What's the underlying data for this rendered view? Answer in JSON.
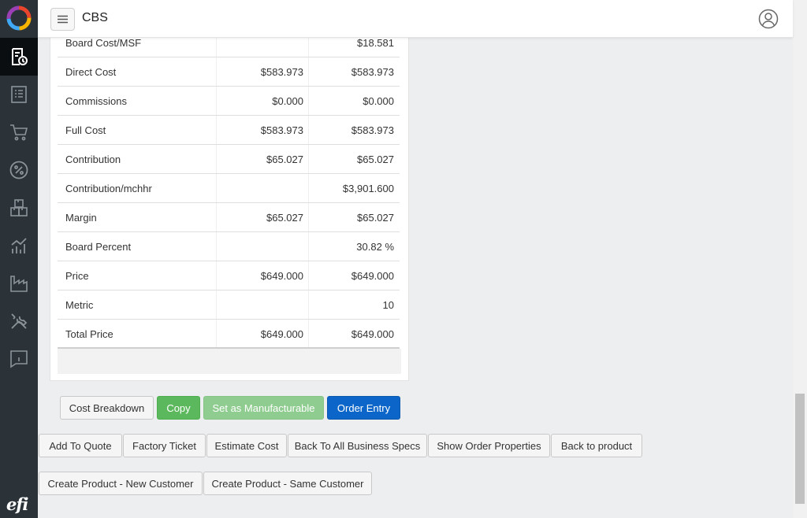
{
  "header": {
    "title": "CBS"
  },
  "sidebar": {
    "items": [
      "estimates-icon",
      "list-icon",
      "cart-icon",
      "percent-icon",
      "boxes-icon",
      "analytics-icon",
      "factory-icon",
      "tools-icon",
      "feedback-icon"
    ],
    "brand": "efi"
  },
  "table": {
    "rows": [
      {
        "label": "Board Cost/MSF",
        "v1": "",
        "v2": "$18.581"
      },
      {
        "label": "Direct Cost",
        "v1": "$583.973",
        "v2": "$583.973"
      },
      {
        "label": "Commissions",
        "v1": "$0.000",
        "v2": "$0.000"
      },
      {
        "label": "Full Cost",
        "v1": "$583.973",
        "v2": "$583.973"
      },
      {
        "label": "Contribution",
        "v1": "$65.027",
        "v2": "$65.027"
      },
      {
        "label": "Contribution/mchhr",
        "v1": "",
        "v2": "$3,901.600"
      },
      {
        "label": "Margin",
        "v1": "$65.027",
        "v2": "$65.027"
      },
      {
        "label": "Board Percent",
        "v1": "",
        "v2": "30.82 %"
      },
      {
        "label": "Price",
        "v1": "$649.000",
        "v2": "$649.000"
      },
      {
        "label": "Metric",
        "v1": "",
        "v2": "10"
      },
      {
        "label": "Total Price",
        "v1": "$649.000",
        "v2": "$649.000"
      }
    ]
  },
  "actions": {
    "cost_breakdown": "Cost Breakdown",
    "copy": "Copy",
    "set_manufacturable": "Set as Manufacturable",
    "order_entry": "Order Entry",
    "add_to_quote": "Add To Quote",
    "factory_ticket": "Factory Ticket",
    "estimate_cost": "Estimate Cost",
    "back_to_specs": "Back To All Business Specs",
    "show_order_properties": "Show Order Properties",
    "back_to_product": "Back to product",
    "create_new_customer": "Create Product - New Customer",
    "create_same_customer": "Create Product - Same Customer"
  },
  "colors": {
    "sidebar": "#2b3238",
    "primary": "#0c66c9",
    "success": "#5cb85c"
  }
}
